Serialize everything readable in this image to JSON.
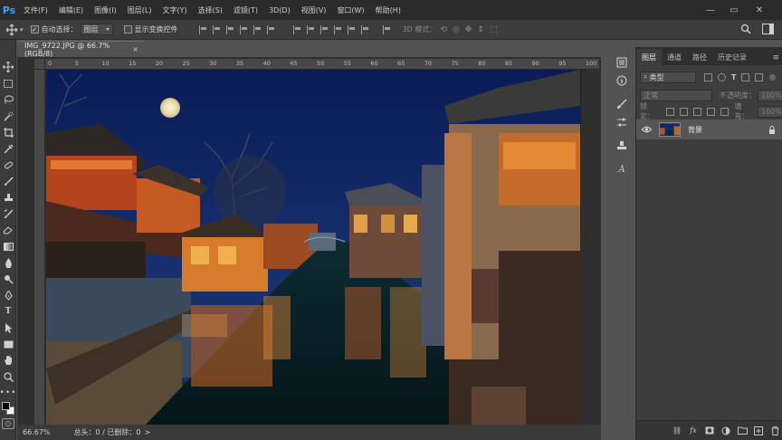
{
  "app": {
    "logo": "Ps"
  },
  "menu": [
    "文件(F)",
    "编辑(E)",
    "图像(I)",
    "图层(L)",
    "文字(Y)",
    "选择(S)",
    "滤镜(T)",
    "3D(D)",
    "视图(V)",
    "窗口(W)",
    "帮助(H)"
  ],
  "window_controls": {
    "minimize": "—",
    "restore": "▭",
    "close": "✕"
  },
  "options": {
    "auto_select_label": "自动选择：",
    "auto_select_checked": "✓",
    "auto_select_value": "图层",
    "show_transform_label": "显示变换控件",
    "mode_3d_label": "3D 模式："
  },
  "document": {
    "tab_title": "IMG_9722.JPG @ 66.7%(RGB/8)",
    "close": "×",
    "ruler_labels": [
      "0",
      "5",
      "10",
      "15",
      "20",
      "25",
      "30",
      "35",
      "40",
      "45",
      "50",
      "55",
      "60",
      "65",
      "70",
      "75",
      "80",
      "85",
      "90",
      "95",
      "100"
    ]
  },
  "status": {
    "zoom": "66.67%",
    "doc_info": "总头：0 / 已删除：0"
  },
  "panel": {
    "tabs": [
      "图层",
      "通道",
      "路径",
      "历史记录"
    ],
    "active_tab": 0,
    "filter_label": "类型",
    "blend_mode": "正常",
    "opacity_label": "不透明度：",
    "opacity_value": "100%",
    "lock_label": "锁定：",
    "fill_label": "填充：",
    "fill_value": "100%",
    "layers": [
      {
        "name": "背景"
      }
    ]
  },
  "icons": {
    "move": "move-icon",
    "marquee": "marquee-icon",
    "lasso": "lasso-icon",
    "quick-select": "quick-select-icon",
    "crop": "crop-icon",
    "eyedropper": "eyedropper-icon",
    "healing": "healing-icon",
    "brush": "brush-icon",
    "stamp": "stamp-icon",
    "history-brush": "history-brush-icon",
    "eraser": "eraser-icon",
    "gradient": "gradient-icon",
    "blur": "blur-icon",
    "dodge": "dodge-icon",
    "pen": "pen-icon",
    "type": "type-icon",
    "path-select": "path-select-icon",
    "shape": "shape-icon",
    "hand": "hand-icon",
    "zoom": "zoom-icon",
    "more": "more-icon"
  }
}
